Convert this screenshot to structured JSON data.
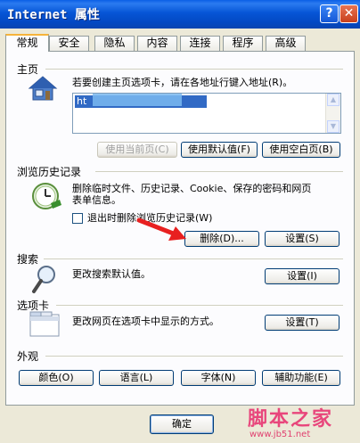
{
  "window": {
    "title": "Internet 属性",
    "help_label": "?",
    "close_label": "✕"
  },
  "tabs": [
    "常规",
    "安全",
    "隐私",
    "内容",
    "连接",
    "程序",
    "高级"
  ],
  "home": {
    "title": "主页",
    "desc": "若要创建主页选项卡，请在各地址行键入地址(R)。",
    "url_visible": "ht",
    "buttons": {
      "use_current": "使用当前页(C)",
      "use_default": "使用默认值(F)",
      "use_blank": "使用空白页(B)"
    }
  },
  "history": {
    "title": "浏览历史记录",
    "desc_line1": "删除临时文件、历史记录、Cookie、保存的密码和网页",
    "desc_line2": "表单信息。",
    "checkbox_label": "退出时删除浏览历史记录(W)",
    "delete_button": "删除(D)...",
    "settings_button": "设置(S)"
  },
  "search": {
    "title": "搜索",
    "desc": "更改搜索默认值。",
    "settings_button": "设置(I)"
  },
  "tabs_section": {
    "title": "选项卡",
    "desc": "更改网页在选项卡中显示的方式。",
    "settings_button": "设置(T)"
  },
  "appearance": {
    "title": "外观",
    "buttons": {
      "colors": "颜色(O)",
      "languages": "语言(L)",
      "fonts": "字体(N)",
      "accessibility": "辅助功能(E)"
    }
  },
  "footer": {
    "ok_button": "确定"
  },
  "watermark": {
    "big": "脚本之家",
    "small": "www.jb51.net"
  },
  "colors": {
    "arrow": "#e82020",
    "titlebar": "#0a5fe6",
    "tab_highlight": "#f6b43b"
  }
}
